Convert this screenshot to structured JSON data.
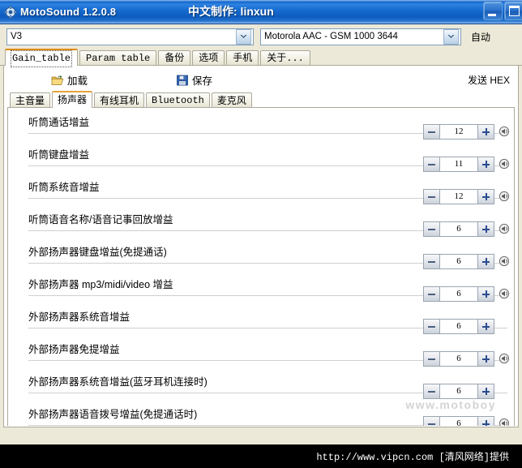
{
  "window": {
    "title": "MotoSound 1.2.0.8",
    "title_center": "中文制作: linxun",
    "app_icon": "gear-icon",
    "buttons": {
      "minimize": "minimize-icon",
      "maximize": "maximize-icon"
    }
  },
  "top_bar": {
    "device_combo": {
      "value": "V3",
      "icon": "chevron-down-icon"
    },
    "profile_combo": {
      "value": "Motorola AAC - GSM 1000 3644",
      "icon": "chevron-down-icon"
    },
    "auto_label": "自动"
  },
  "main_tabs": [
    {
      "label": "Gain_table",
      "selected": true
    },
    {
      "label": "Param table",
      "selected": false
    },
    {
      "label": "备份",
      "selected": false
    },
    {
      "label": "选项",
      "selected": false
    },
    {
      "label": "手机",
      "selected": false
    },
    {
      "label": "关于...",
      "selected": false
    }
  ],
  "toolbar": {
    "load_label": "加载",
    "load_icon": "open-folder-icon",
    "save_label": "保存",
    "save_icon": "floppy-disk-icon",
    "send_label": "发送 HEX"
  },
  "sub_tabs": [
    {
      "label": "主音量",
      "selected": false,
      "mono": false
    },
    {
      "label": "扬声器",
      "selected": true,
      "mono": false
    },
    {
      "label": "有线耳机",
      "selected": false,
      "mono": false
    },
    {
      "label": "Bluetooth",
      "selected": false,
      "mono": true
    },
    {
      "label": "麦克风",
      "selected": false,
      "mono": false
    }
  ],
  "gain_rows": [
    {
      "label": "听筒通话增益",
      "value": "12",
      "has_icon": true
    },
    {
      "label": "听筒键盘增益",
      "value": "11",
      "has_icon": true
    },
    {
      "label": "听筒系统音增益",
      "value": "12",
      "has_icon": true
    },
    {
      "label": "听筒语音名称/语音记事回放增益",
      "value": "6",
      "has_icon": true
    },
    {
      "label": "外部扬声器键盘增益(免提通话)",
      "value": "6",
      "has_icon": true
    },
    {
      "label": "外部扬声器 mp3/midi/video 增益",
      "value": "6",
      "has_icon": true,
      "mono_part": "mp3/midi/video"
    },
    {
      "label": "外部扬声器系统音增益",
      "value": "6",
      "has_icon": false
    },
    {
      "label": "外部扬声器免提增益",
      "value": "6",
      "has_icon": true
    },
    {
      "label": "外部扬声器系统音增益(蓝牙耳机连接时)",
      "value": "6",
      "has_icon": false
    },
    {
      "label": "外部扬声器语音拨号增益(免提通话时)",
      "value": "6",
      "has_icon": true
    }
  ],
  "spinner_controls": {
    "decrement": "−",
    "increment": "+",
    "row_icon": "speaker-icon"
  },
  "watermark": "www.motoboy",
  "footer": {
    "text": "http://www.vipcn.com [清风网络]提供"
  },
  "colors": {
    "titlebar_blue": "#1165c9",
    "selected_tab_orange": "#e08a10",
    "panel_bg": "#ece9d8",
    "footer_bg": "#000000"
  }
}
